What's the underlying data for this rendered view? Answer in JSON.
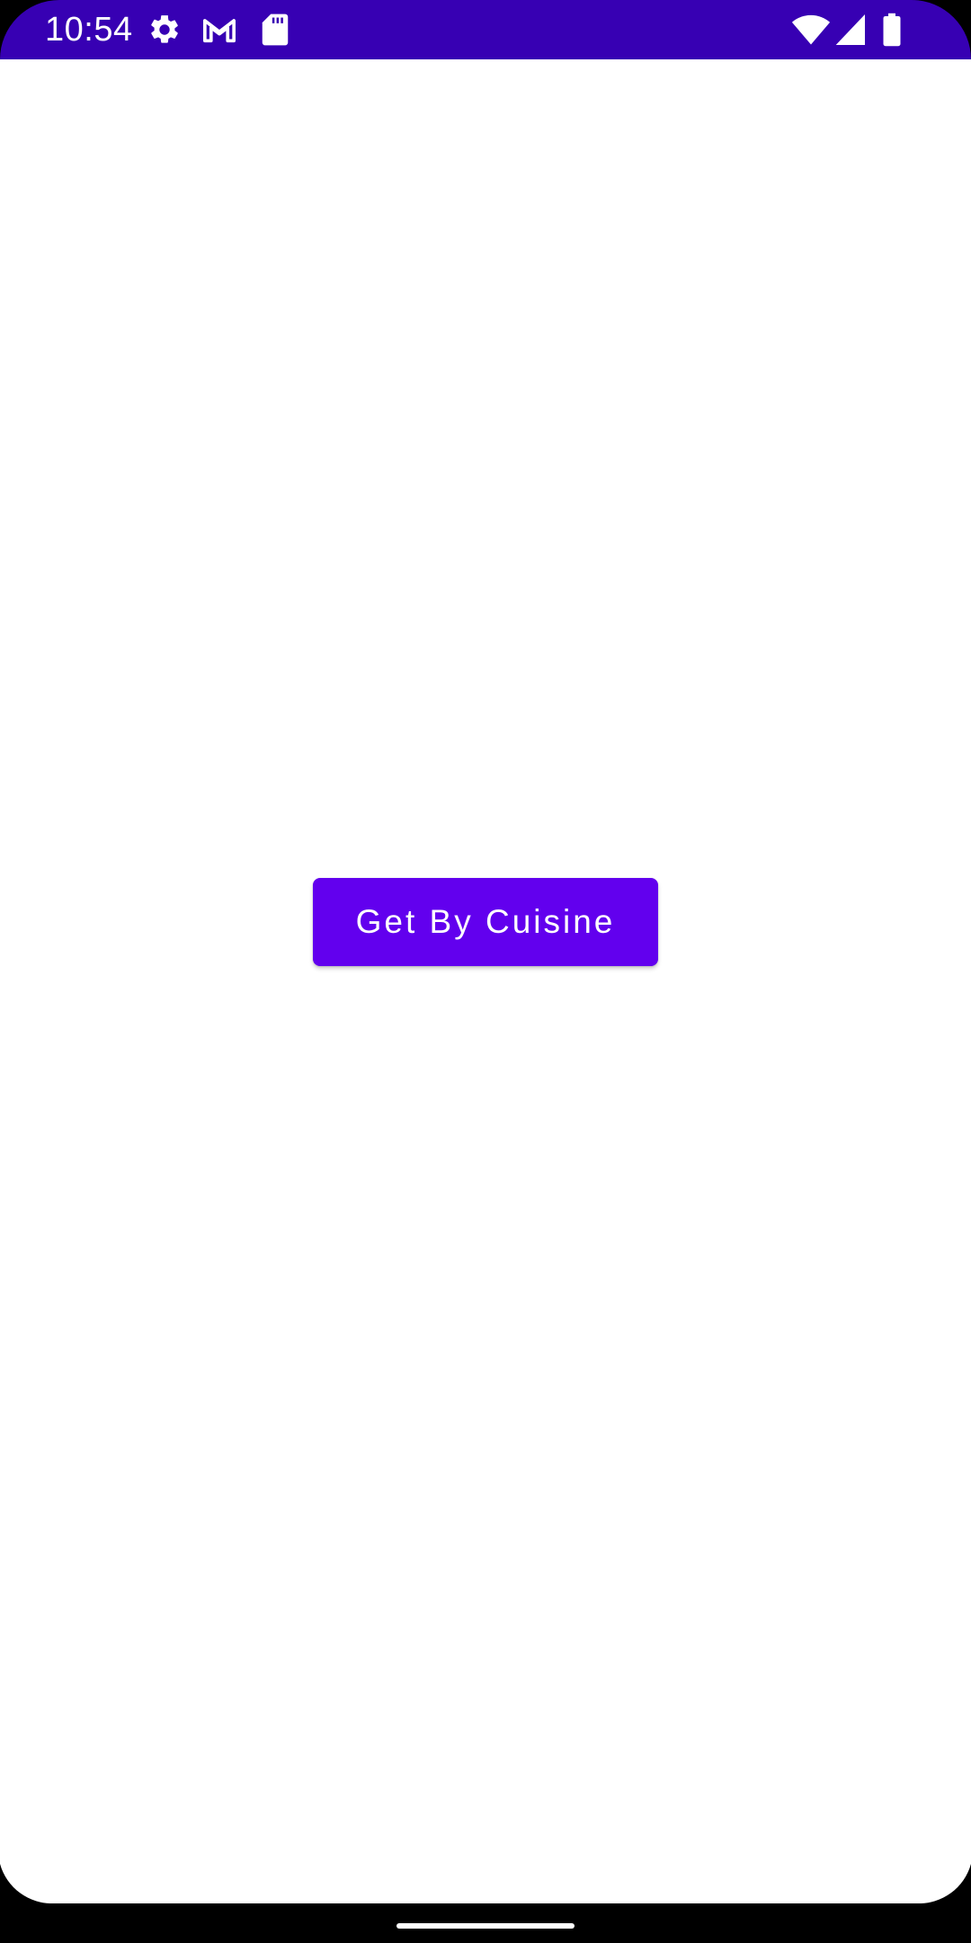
{
  "status_bar": {
    "time": "10:54",
    "left_icons": [
      "gear-icon",
      "gmail-icon",
      "sd-card-icon"
    ],
    "right_icons": [
      "wifi-icon",
      "signal-icon",
      "battery-icon"
    ],
    "background_color": "#3700b3"
  },
  "main": {
    "button_label": "Get By Cuisine",
    "button_color": "#6200ee"
  }
}
